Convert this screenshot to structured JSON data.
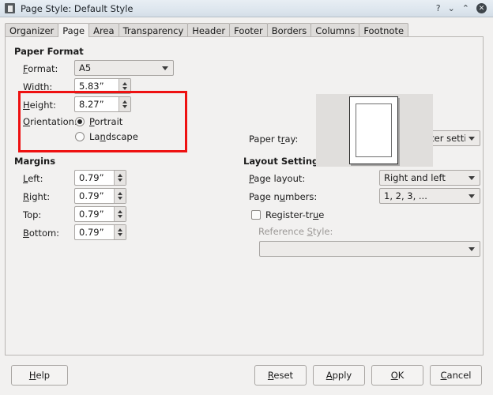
{
  "window": {
    "title": "Page Style: Default Style",
    "icon": "document-icon",
    "buttons": {
      "help": "?",
      "minimize": "⌄",
      "maximize": "⌃",
      "close": "✕"
    }
  },
  "tabs": [
    {
      "label": "Organizer",
      "active": false
    },
    {
      "label": "Page",
      "active": true
    },
    {
      "label": "Area",
      "active": false
    },
    {
      "label": "Transparency",
      "active": false
    },
    {
      "label": "Header",
      "active": false
    },
    {
      "label": "Footer",
      "active": false
    },
    {
      "label": "Borders",
      "active": false
    },
    {
      "label": "Columns",
      "active": false
    },
    {
      "label": "Footnote",
      "active": false
    }
  ],
  "paper_format": {
    "title": "Paper Format",
    "format_label": "Format:",
    "format_value": "A5",
    "width_label": "Width:",
    "width_value": "5.83”",
    "height_label": "Height:",
    "height_value": "8.27”",
    "orientation_label": "Orientation:",
    "portrait_label": "Portrait",
    "landscape_label": "Landscape",
    "orientation_selected": "Portrait",
    "highlight_color": "#ee1111"
  },
  "margins": {
    "title": "Margins",
    "left_label": "Left:",
    "left_value": "0.79”",
    "right_label": "Right:",
    "right_value": "0.79”",
    "top_label": "Top:",
    "top_value": "0.79”",
    "bottom_label": "Bottom:",
    "bottom_value": "0.79”"
  },
  "paper_tray": {
    "label": "Paper tray:",
    "value": "[From printer settings]"
  },
  "layout_settings": {
    "title": "Layout Settings",
    "page_layout_label": "Page layout:",
    "page_layout_value": "Right and left",
    "page_numbers_label": "Page numbers:",
    "page_numbers_value": "1, 2, 3, ...",
    "register_true_label": "Register-true",
    "register_true_checked": false,
    "reference_style_label": "Reference Style:",
    "reference_style_value": ""
  },
  "footer_buttons": {
    "help": "Help",
    "reset": "Reset",
    "apply": "Apply",
    "ok": "OK",
    "cancel": "Cancel"
  }
}
